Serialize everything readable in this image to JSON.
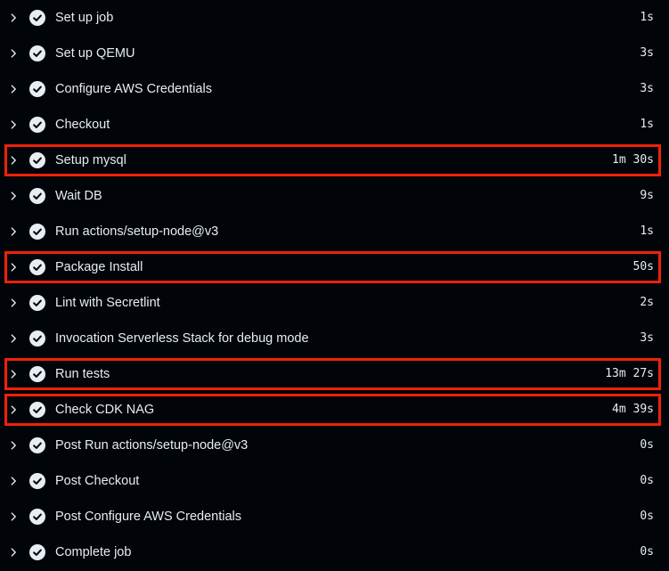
{
  "steps": [
    {
      "label": "Set up job",
      "duration": "1s",
      "highlighted": false
    },
    {
      "label": "Set up QEMU",
      "duration": "3s",
      "highlighted": false
    },
    {
      "label": "Configure AWS Credentials",
      "duration": "3s",
      "highlighted": false
    },
    {
      "label": "Checkout",
      "duration": "1s",
      "highlighted": false
    },
    {
      "label": "Setup mysql",
      "duration": "1m 30s",
      "highlighted": true
    },
    {
      "label": "Wait DB",
      "duration": "9s",
      "highlighted": false
    },
    {
      "label": "Run actions/setup-node@v3",
      "duration": "1s",
      "highlighted": false
    },
    {
      "label": "Package Install",
      "duration": "50s",
      "highlighted": true
    },
    {
      "label": "Lint with Secretlint",
      "duration": "2s",
      "highlighted": false
    },
    {
      "label": "Invocation Serverless Stack for debug mode",
      "duration": "3s",
      "highlighted": false
    },
    {
      "label": "Run tests",
      "duration": "13m 27s",
      "highlighted": true
    },
    {
      "label": "Check CDK NAG",
      "duration": "4m 39s",
      "highlighted": true
    },
    {
      "label": "Post Run actions/setup-node@v3",
      "duration": "0s",
      "highlighted": false
    },
    {
      "label": "Post Checkout",
      "duration": "0s",
      "highlighted": false
    },
    {
      "label": "Post Configure AWS Credentials",
      "duration": "0s",
      "highlighted": false
    },
    {
      "label": "Complete job",
      "duration": "0s",
      "highlighted": false
    }
  ],
  "icons": {
    "expand": "chevron-right-icon",
    "status": "check-circle-icon"
  },
  "colors": {
    "background": "#010409",
    "text": "#e6edf3",
    "highlight_border": "#f0200a"
  }
}
